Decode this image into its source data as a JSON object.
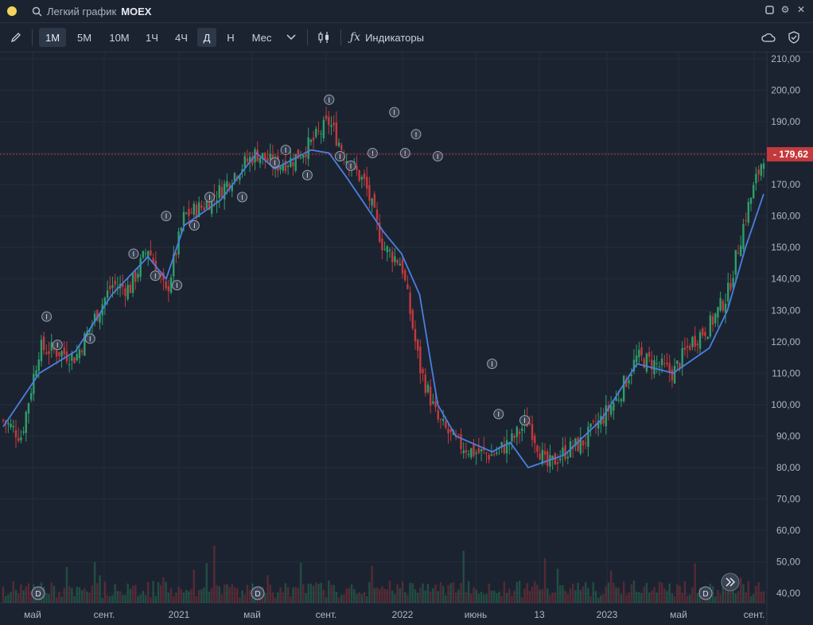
{
  "window": {
    "search_label": "Легкий график",
    "ticker": "MOEX"
  },
  "toolbar": {
    "periods": [
      "1М",
      "5М",
      "10М",
      "1Ч",
      "4Ч",
      "Д",
      "Н",
      "Мес"
    ],
    "active_periods": [
      "1М",
      "Д"
    ],
    "indicators_label": "Индикаторы"
  },
  "icons": {
    "pencil": "pencil-icon",
    "dropdown": "chevron-down-icon",
    "candles": "candles-icon",
    "fx": "fx-icon",
    "cloud": "cloud-icon",
    "shield": "shield-icon",
    "search": "search-icon",
    "window": "window-icon",
    "settings": "gear-icon",
    "close": "close-icon"
  },
  "chart_data": {
    "type": "candlestick",
    "title": "",
    "price_axis": {
      "ticks": [
        "210,00",
        "200,00",
        "190,00",
        "180,00",
        "170,00",
        "160,00",
        "150,00",
        "140,00",
        "130,00",
        "120,00",
        "110,00",
        "100,00",
        "90,00",
        "80,00",
        "70,00",
        "60,00",
        "50,00",
        "40,00"
      ],
      "range": [
        37,
        212
      ]
    },
    "time_axis": {
      "labels": [
        "май",
        "сент.",
        "2021",
        "май",
        "сент.",
        "2022",
        "июнь",
        "13",
        "2023",
        "май",
        "сент."
      ]
    },
    "last_price": {
      "value": 179.62,
      "label": "179,62",
      "color": "#c4393c"
    },
    "colors": {
      "up": "#2e9e6b",
      "down": "#c4393c",
      "ma": "#4a7fe0",
      "background": "#1c2330",
      "grid": "#252d3a"
    },
    "close_path": [
      [
        "2020-03",
        95
      ],
      [
        "2020-04",
        90
      ],
      [
        "2020-05",
        118
      ],
      [
        "2020-06",
        117
      ],
      [
        "2020-07",
        115
      ],
      [
        "2020-08",
        127
      ],
      [
        "2020-09",
        138
      ],
      [
        "2020-10",
        137
      ],
      [
        "2020-11",
        150
      ],
      [
        "2020-12",
        135
      ],
      [
        "2021-01",
        160
      ],
      [
        "2021-02",
        163
      ],
      [
        "2021-03",
        168
      ],
      [
        "2021-04",
        175
      ],
      [
        "2021-05",
        180
      ],
      [
        "2021-06",
        176
      ],
      [
        "2021-07",
        178
      ],
      [
        "2021-08",
        183
      ],
      [
        "2021-09",
        190
      ],
      [
        "2021-10",
        178
      ],
      [
        "2021-11",
        170
      ],
      [
        "2021-12",
        150
      ],
      [
        "2022-01",
        145
      ],
      [
        "2022-02",
        112
      ],
      [
        "2022-03",
        95
      ],
      [
        "2022-04",
        88
      ],
      [
        "2022-05",
        85
      ],
      [
        "2022-06",
        84
      ],
      [
        "2022-07",
        88
      ],
      [
        "2022-08",
        95
      ],
      [
        "2022-09",
        80
      ],
      [
        "2022-10",
        85
      ],
      [
        "2022-11",
        88
      ],
      [
        "2022-12",
        95
      ],
      [
        "2023-01",
        103
      ],
      [
        "2023-02",
        115
      ],
      [
        "2023-03",
        113
      ],
      [
        "2023-04",
        110
      ],
      [
        "2023-05",
        120
      ],
      [
        "2023-06",
        125
      ],
      [
        "2023-07",
        135
      ],
      [
        "2023-08",
        160
      ],
      [
        "2023-09",
        179.62
      ]
    ],
    "moving_average": [
      [
        "2020-03",
        93
      ],
      [
        "2020-05",
        110
      ],
      [
        "2020-07",
        117
      ],
      [
        "2020-09",
        135
      ],
      [
        "2020-11",
        147
      ],
      [
        "2020-12",
        140
      ],
      [
        "2021-01",
        157
      ],
      [
        "2021-03",
        165
      ],
      [
        "2021-05",
        180
      ],
      [
        "2021-06",
        175
      ],
      [
        "2021-08",
        181
      ],
      [
        "2021-09",
        180
      ],
      [
        "2021-10",
        172
      ],
      [
        "2021-12",
        155
      ],
      [
        "2022-01",
        148
      ],
      [
        "2022-02",
        135
      ],
      [
        "2022-03",
        100
      ],
      [
        "2022-04",
        90
      ],
      [
        "2022-06",
        85
      ],
      [
        "2022-07",
        88
      ],
      [
        "2022-08",
        80
      ],
      [
        "2022-10",
        84
      ],
      [
        "2022-12",
        95
      ],
      [
        "2023-02",
        113
      ],
      [
        "2023-04",
        110
      ],
      [
        "2023-06",
        118
      ],
      [
        "2023-07",
        130
      ],
      [
        "2023-08",
        150
      ],
      [
        "2023-09",
        167
      ]
    ],
    "event_markers": {
      "dividend_label": "D",
      "info_label": "I"
    }
  }
}
